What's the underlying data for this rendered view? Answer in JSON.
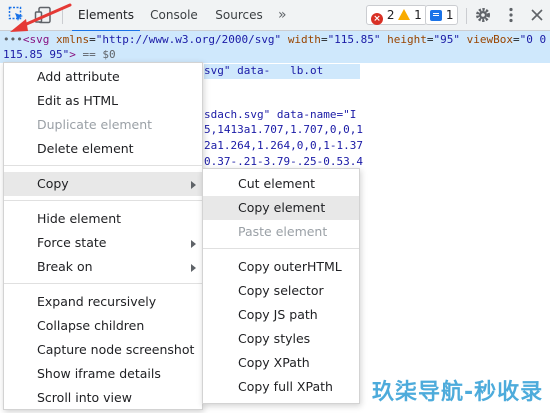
{
  "devtools": {
    "tabs": [
      {
        "label": "Elements",
        "active": true
      },
      {
        "label": "Console",
        "active": false
      },
      {
        "label": "Sources",
        "active": false
      }
    ],
    "more_tabs_glyph": "»",
    "counters": {
      "errors": "2",
      "warnings": "1",
      "messages": "1"
    }
  },
  "source": {
    "line1": {
      "ellipsis": "•••",
      "tag_open": "<svg",
      "attrs": [
        {
          "name": "xmlns",
          "value": "\"http://www.w3.org/2000/svg\""
        },
        {
          "name": "width",
          "value": "\"115.85\""
        },
        {
          "name": "height",
          "value": "\"95\""
        },
        {
          "name": "viewBox",
          "value": "\"0 0"
        }
      ]
    },
    "line2": {
      "value_cont": "115.85 95\"",
      "tag_close": ">",
      "marker": " == $0"
    },
    "bg_fragments": [
      "sdach.svg\" data-name=\"I",
      "5,1413a1.707,1.707,0,0,1",
      "2a1.264,1.264,0,0,1-1.37",
      "0.37-.21-3.79-.25-0.53.4"
    ],
    "bg_top_fragment": "svg\" data-   lb.ot"
  },
  "context_menu": {
    "items": [
      {
        "label": "Add attribute",
        "disabled": false
      },
      {
        "label": "Edit as HTML",
        "disabled": false
      },
      {
        "label": "Duplicate element",
        "disabled": true
      },
      {
        "label": "Delete element",
        "disabled": false
      },
      {
        "label": "Copy",
        "disabled": false,
        "submenu": true,
        "highlighted": true
      },
      {
        "label": "Hide element",
        "disabled": false
      },
      {
        "label": "Force state",
        "disabled": false,
        "submenu": true
      },
      {
        "label": "Break on",
        "disabled": false,
        "submenu": true
      },
      {
        "label": "Expand recursively",
        "disabled": false
      },
      {
        "label": "Collapse children",
        "disabled": false
      },
      {
        "label": "Capture node screenshot",
        "disabled": false
      },
      {
        "label": "Show iframe details",
        "disabled": false
      },
      {
        "label": "Scroll into view",
        "disabled": false
      }
    ]
  },
  "copy_submenu": {
    "items": [
      {
        "label": "Cut element",
        "disabled": false
      },
      {
        "label": "Copy element",
        "disabled": false,
        "highlighted": true
      },
      {
        "label": "Paste element",
        "disabled": true
      },
      {
        "label": "Copy outerHTML",
        "disabled": false
      },
      {
        "label": "Copy selector",
        "disabled": false
      },
      {
        "label": "Copy JS path",
        "disabled": false
      },
      {
        "label": "Copy styles",
        "disabled": false
      },
      {
        "label": "Copy XPath",
        "disabled": false
      },
      {
        "label": "Copy full XPath",
        "disabled": false
      }
    ]
  },
  "watermark": "玖柒导航-秒收录",
  "colors": {
    "accent": "#1a73e8",
    "error": "#d93025",
    "warning": "#f9ab00",
    "watermark": "#3aa3d8"
  }
}
